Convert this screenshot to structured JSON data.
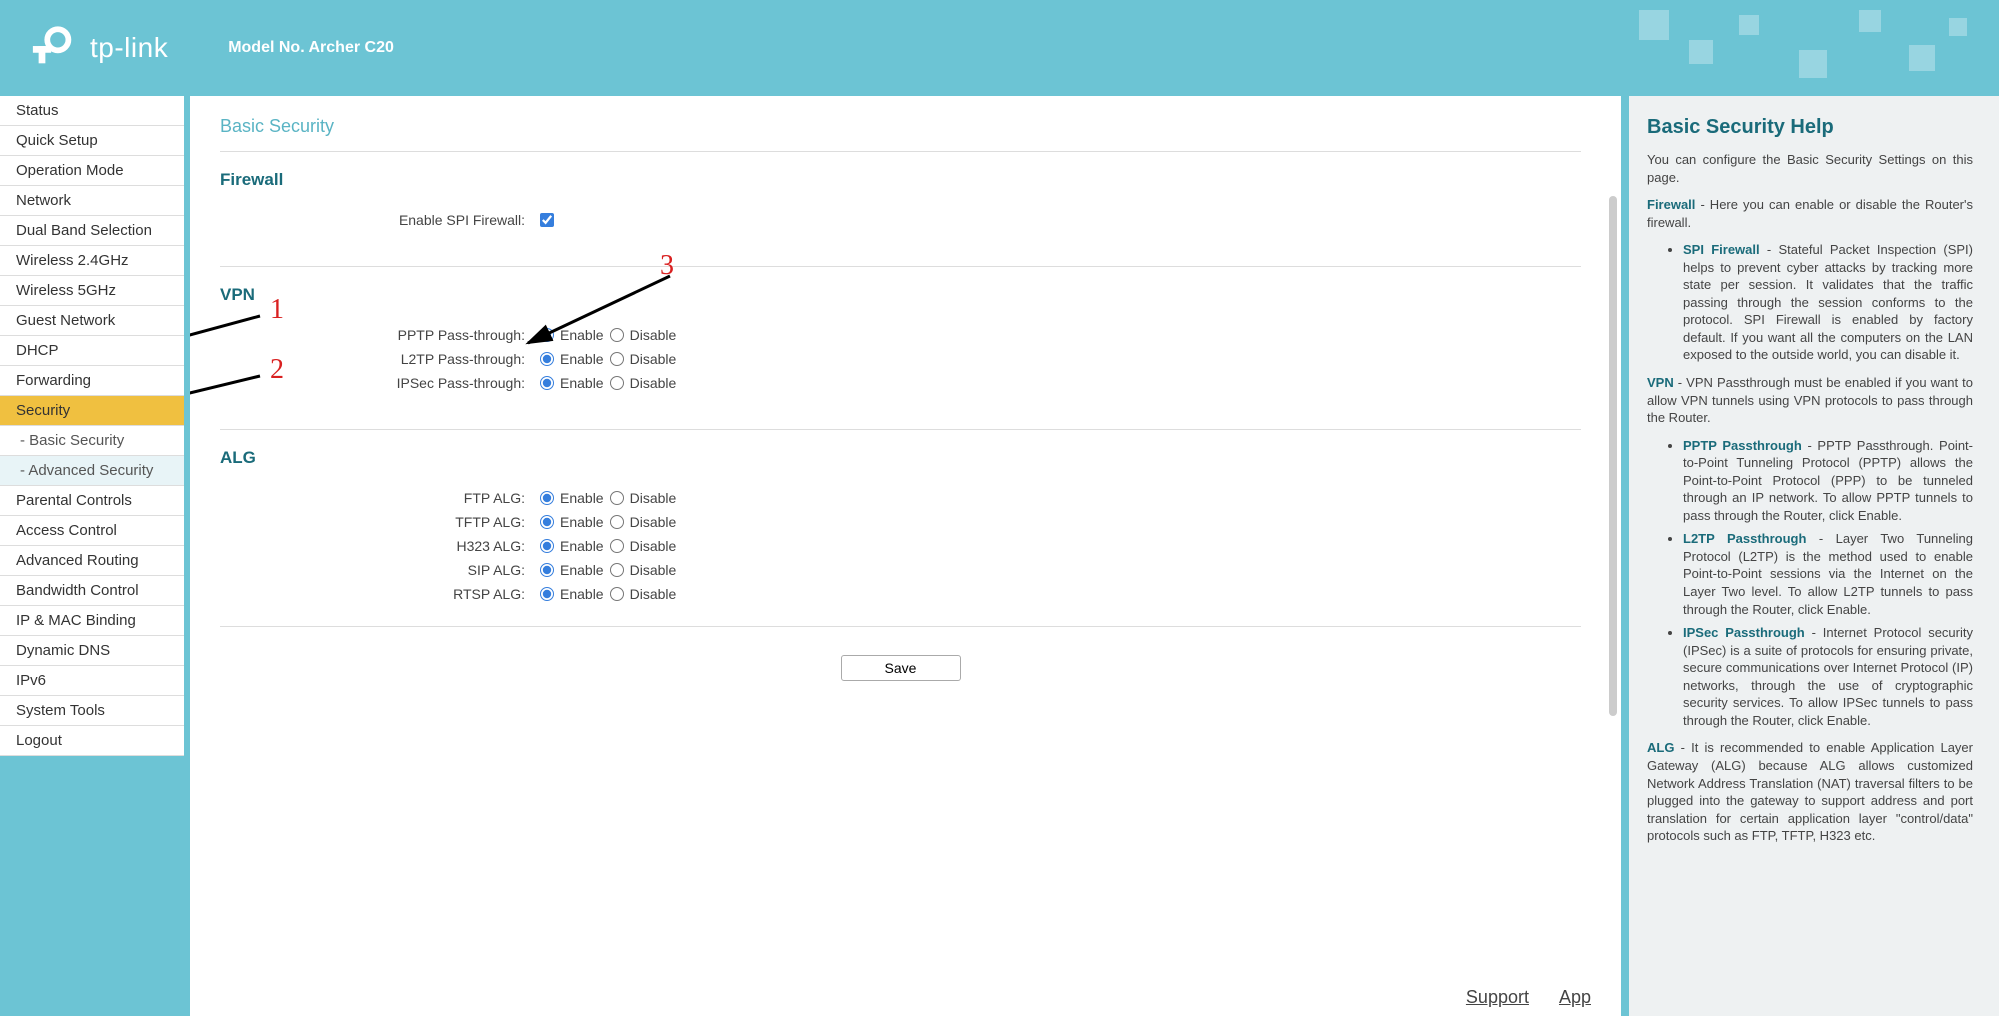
{
  "header": {
    "brand": "tp-link",
    "model": "Model No. Archer C20"
  },
  "sidebar": {
    "items": [
      {
        "label": "Status"
      },
      {
        "label": "Quick Setup"
      },
      {
        "label": "Operation Mode"
      },
      {
        "label": "Network"
      },
      {
        "label": "Dual Band Selection"
      },
      {
        "label": "Wireless 2.4GHz"
      },
      {
        "label": "Wireless 5GHz"
      },
      {
        "label": "Guest Network"
      },
      {
        "label": "DHCP"
      },
      {
        "label": "Forwarding"
      },
      {
        "label": "Security"
      },
      {
        "label": "- Basic Security"
      },
      {
        "label": "- Advanced Security"
      },
      {
        "label": "Parental Controls"
      },
      {
        "label": "Access Control"
      },
      {
        "label": "Advanced Routing"
      },
      {
        "label": "Bandwidth Control"
      },
      {
        "label": "IP & MAC Binding"
      },
      {
        "label": "Dynamic DNS"
      },
      {
        "label": "IPv6"
      },
      {
        "label": "System Tools"
      },
      {
        "label": "Logout"
      }
    ]
  },
  "main": {
    "page_title": "Basic Security",
    "enable_label": "Enable",
    "disable_label": "Disable",
    "save_label": "Save",
    "sections": {
      "firewall": {
        "heading": "Firewall",
        "spi_label": "Enable SPI Firewall:"
      },
      "vpn": {
        "heading": "VPN",
        "rows": [
          {
            "label": "PPTP Pass-through:"
          },
          {
            "label": "L2TP Pass-through:"
          },
          {
            "label": "IPSec Pass-through:"
          }
        ]
      },
      "alg": {
        "heading": "ALG",
        "rows": [
          {
            "label": "FTP ALG:"
          },
          {
            "label": "TFTP ALG:"
          },
          {
            "label": "H323 ALG:"
          },
          {
            "label": "SIP ALG:"
          },
          {
            "label": "RTSP ALG:"
          }
        ]
      }
    }
  },
  "footer": {
    "support": "Support",
    "app": "App"
  },
  "help": {
    "title": "Basic Security Help",
    "intro": "You can configure the Basic Security Settings on this page.",
    "firewall_kw": "Firewall",
    "firewall_body": " - Here you can enable or disable the Router's firewall.",
    "spi_kw": "SPI Firewall",
    "spi_body": " - Stateful Packet Inspection (SPI) helps to prevent cyber attacks by tracking more state per session. It validates that the traffic passing through the session conforms to the protocol. SPI Firewall is enabled by factory default. If you want all the computers on the LAN exposed to the outside world, you can disable it.",
    "vpn_kw": "VPN",
    "vpn_body": " - VPN Passthrough must be enabled if you want to allow VPN tunnels using VPN protocols to pass through the Router.",
    "pptp_kw": "PPTP Passthrough",
    "pptp_body": " - PPTP Passthrough. Point-to-Point Tunneling Protocol (PPTP) allows the Point-to-Point Protocol (PPP) to be tunneled through an IP network. To allow PPTP tunnels to pass through the Router, click Enable.",
    "l2tp_kw": "L2TP Passthrough",
    "l2tp_body": " - Layer Two Tunneling Protocol (L2TP) is the method used to enable Point-to-Point sessions via the Internet on the Layer Two level. To allow L2TP tunnels to pass through the Router, click Enable.",
    "ipsec_kw": "IPSec Passthrough",
    "ipsec_body": " - Internet Protocol security (IPSec) is a suite of protocols for ensuring private, secure communications over Internet Protocol (IP) networks, through the use of cryptographic security services. To allow IPSec tunnels to pass through the Router, click Enable.",
    "alg_kw": "ALG",
    "alg_body": " - It is recommended to enable Application Layer Gateway (ALG) because ALG allows customized Network Address Translation (NAT) traversal filters to be plugged into the gateway to support address and port translation for certain application layer \"control/data\" protocols such as FTP, TFTP, H323 etc."
  },
  "annotations": {
    "n1": "1",
    "n2": "2",
    "n3": "3"
  }
}
